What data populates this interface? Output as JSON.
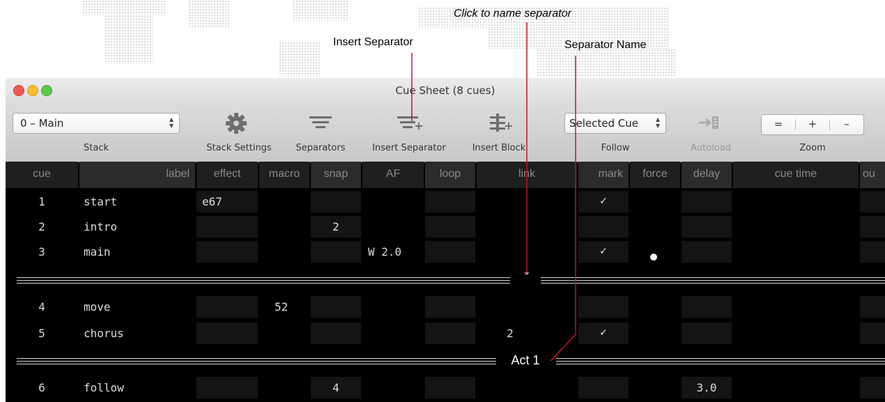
{
  "callouts": {
    "click_to_name": "Click to name separator",
    "insert_separator": "Insert Separator",
    "separator_name": "Separator Name"
  },
  "window": {
    "title": "Cue Sheet (8 cues)"
  },
  "toolbar": {
    "stack_popup_value": "0 – Main",
    "stack_label": "Stack",
    "stack_settings_label": "Stack Settings",
    "separators_label": "Separators",
    "insert_separator_label": "Insert Separator",
    "insert_block_label": "Insert Block",
    "follow_popup_value": "Selected Cue",
    "follow_label": "Follow",
    "autoload_label": "Autoload",
    "zoom_label": "Zoom",
    "zoom_buttons": [
      "=",
      "+",
      "–"
    ],
    "icons": {
      "stack_settings": "gear-icon",
      "separators": "separators-icon",
      "insert_separator": "insert-separator-icon",
      "insert_block": "insert-block-icon",
      "autoload": "autoload-icon"
    }
  },
  "grid": {
    "columns": [
      "cue",
      "label",
      "effect",
      "macro",
      "snap",
      "AF",
      "loop",
      "link",
      "mark",
      "force",
      "delay",
      "cue time",
      "ou"
    ],
    "rows": [
      {
        "cue": "1",
        "label": "start",
        "effect": "e67",
        "macro": "",
        "snap": "",
        "af": "",
        "loop": "",
        "link": "",
        "mark": "✓",
        "force": "",
        "delay": ""
      },
      {
        "cue": "2",
        "label": "intro",
        "effect": "",
        "macro": "",
        "snap": "2",
        "af": "",
        "loop": "",
        "link": "",
        "mark": "",
        "force": "",
        "delay": ""
      },
      {
        "cue": "3",
        "label": "main",
        "effect": "",
        "macro": "",
        "snap": "",
        "af": "W 2.0",
        "loop": "",
        "link": "",
        "mark": "✓",
        "force": "●",
        "delay": ""
      },
      {
        "cue": "4",
        "label": "move",
        "effect": "",
        "macro": "52",
        "snap": "",
        "af": "",
        "loop": "",
        "link": "",
        "mark": "",
        "force": "",
        "delay": ""
      },
      {
        "cue": "5",
        "label": "chorus",
        "effect": "",
        "macro": "",
        "snap": "",
        "af": "",
        "loop": "",
        "link": "2",
        "mark": "✓",
        "force": "",
        "delay": ""
      },
      {
        "cue": "6",
        "label": "follow",
        "effect": "",
        "macro": "",
        "snap": "4",
        "af": "",
        "loop": "",
        "link": "",
        "mark": "",
        "force": "",
        "delay": "3.0"
      }
    ],
    "separators": [
      {
        "name": "*"
      },
      {
        "name": "Act 1"
      }
    ]
  },
  "colors": {
    "grid_background": "#000000",
    "header_background": "#1f1f1f",
    "callout_line": "#c8102e"
  }
}
